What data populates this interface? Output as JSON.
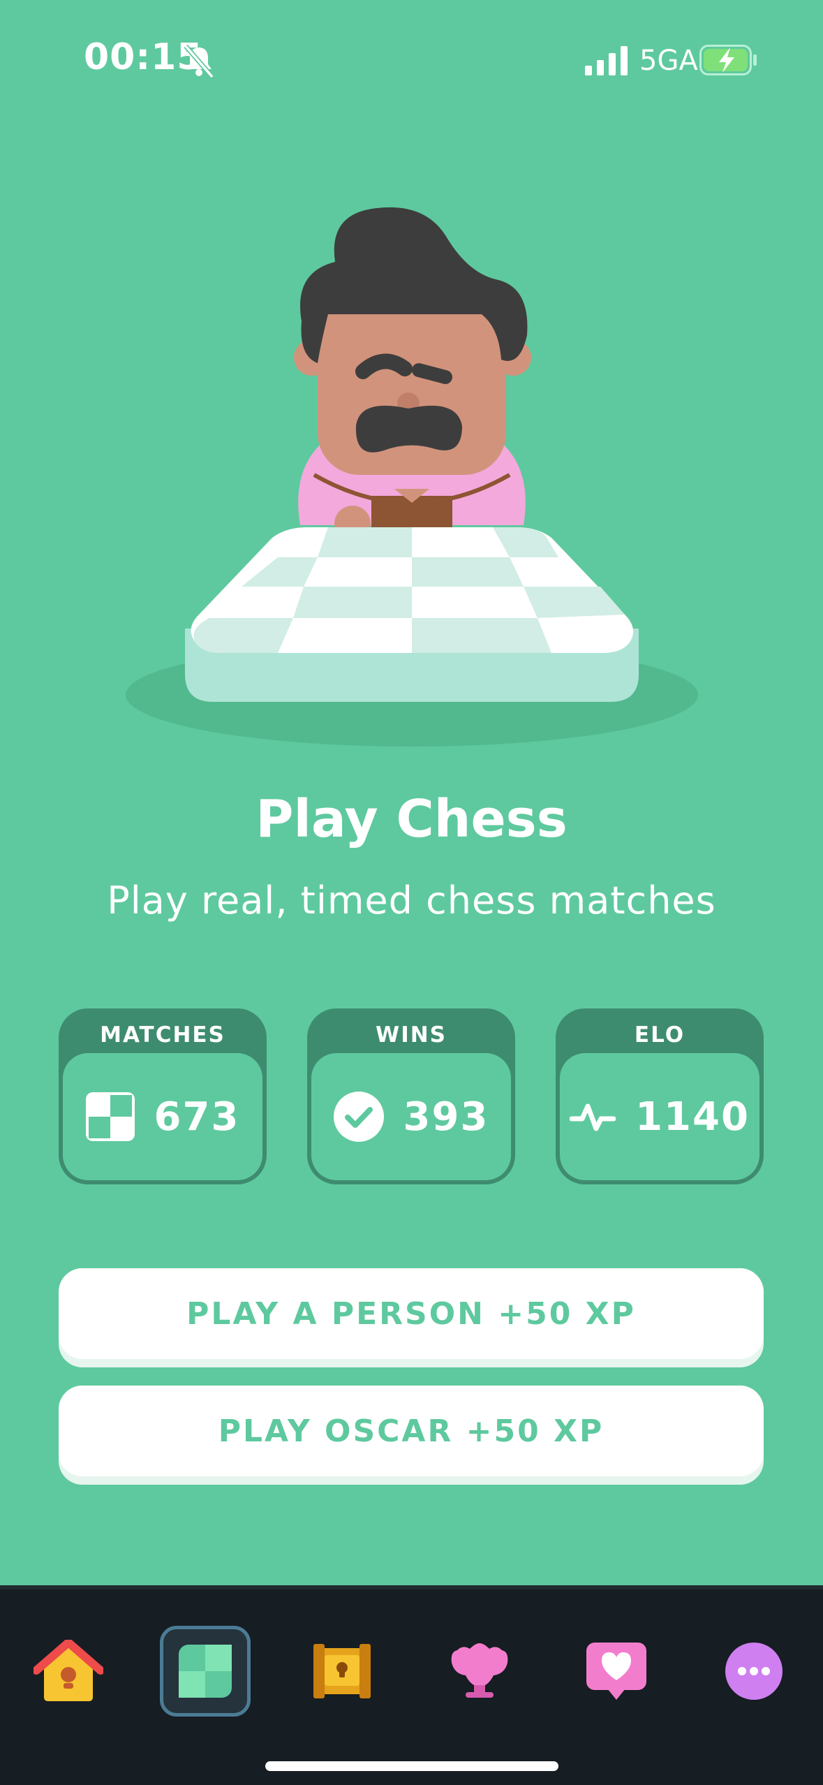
{
  "status_bar": {
    "time": "00:15",
    "network": "5GA"
  },
  "hero": {
    "title": "Play Chess",
    "subtitle": "Play real, timed chess matches"
  },
  "stats": [
    {
      "label": "MATCHES",
      "value": "673",
      "icon": "board-icon"
    },
    {
      "label": "WINS",
      "value": "393",
      "icon": "check-icon"
    },
    {
      "label": "ELO",
      "value": "1140",
      "icon": "pulse-icon"
    }
  ],
  "buttons": {
    "play_person": "PLAY A PERSON +50 XP",
    "play_oscar": "PLAY OSCAR +50 XP"
  },
  "tabs": [
    "home-icon",
    "chess-icon",
    "treasure-chest-icon",
    "trophy-icon",
    "heart-chat-icon",
    "more-icon"
  ],
  "colors": {
    "background": "#5ec99e",
    "stat_frame": "#3e8c70",
    "tab_bar": "#161d23",
    "accent": "#5ec99e"
  }
}
